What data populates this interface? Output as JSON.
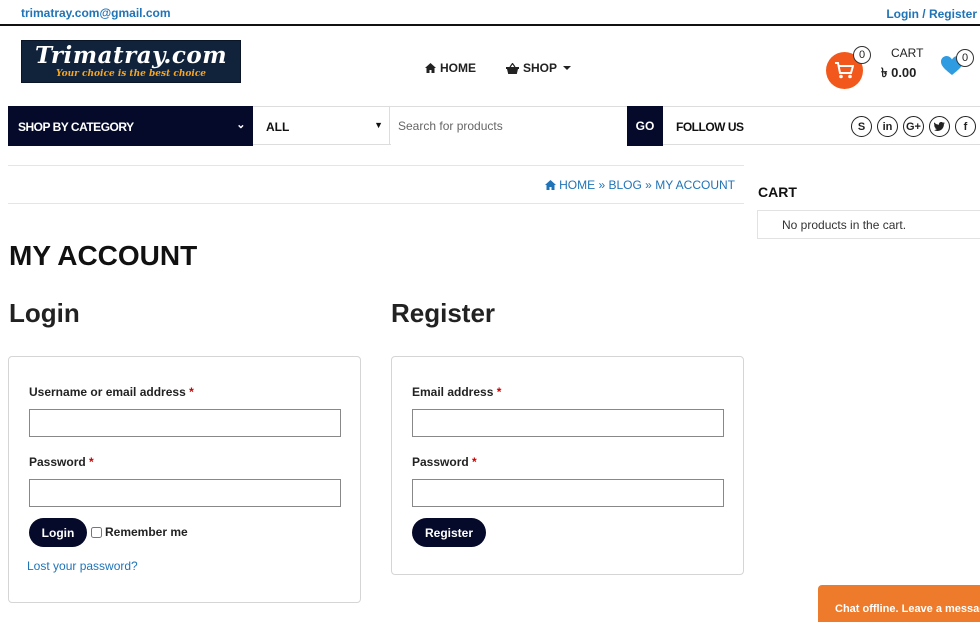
{
  "topbar": {
    "email": "trimatray.com@gmail.com",
    "login_register": "Login / Register"
  },
  "logo": {
    "name": "Trimatray.com",
    "tagline": "Your choice is the best choice"
  },
  "nav": {
    "home": "HOME",
    "shop": "SHOP"
  },
  "cart_widget": {
    "count": "0",
    "label": "CART",
    "total": "৳ 0.00"
  },
  "wishlist": {
    "count": "0"
  },
  "search_bar": {
    "category_label": "SHOP BY CATEGORY",
    "category_select": "ALL",
    "placeholder": "Search for products",
    "go_label": "GO",
    "follow_label": "FOLLOW US"
  },
  "social_icons": [
    "skype-icon",
    "linkedin-icon",
    "google-plus-icon",
    "twitter-icon",
    "facebook-icon"
  ],
  "breadcrumb": {
    "home": "HOME",
    "blog": "BLOG",
    "current": "MY ACCOUNT",
    "separator": "»"
  },
  "page_title": "MY ACCOUNT",
  "login": {
    "title": "Login",
    "username_label": "Username or email address",
    "password_label": "Password",
    "required_mark": "*",
    "button": "Login",
    "remember": "Remember me",
    "lost_password": "Lost your password?"
  },
  "register": {
    "title": "Register",
    "email_label": "Email address",
    "password_label": "Password",
    "required_mark": "*",
    "button": "Register"
  },
  "sidebar": {
    "cart_title": "CART",
    "cart_empty": "No products in the cart."
  },
  "chat": {
    "label": "Chat offline. Leave a message"
  },
  "colors": {
    "link_blue": "#1f73b7",
    "navy": "#050a2a",
    "cart_orange": "#f2581c",
    "chat_orange": "#ee7b2b",
    "heart_blue": "#2f9be0"
  }
}
